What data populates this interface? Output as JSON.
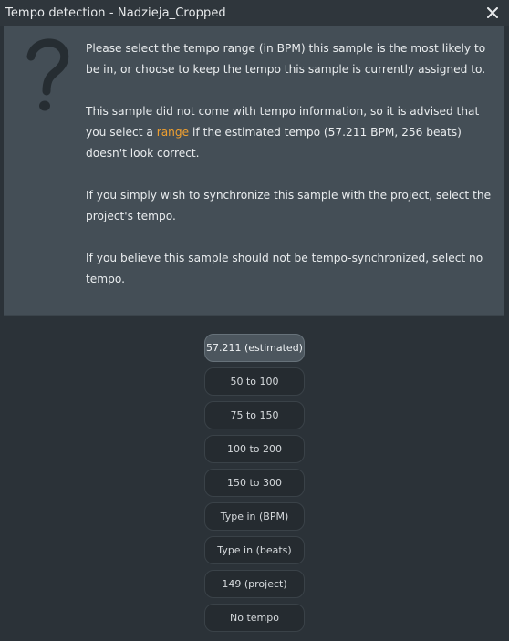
{
  "window": {
    "title": "Tempo detection - Nadzieja_Cropped",
    "close_icon": "close-x-icon"
  },
  "message": {
    "icon": "question-mark-icon",
    "paragraphs": {
      "p1": "Please select the tempo range (in BPM) this sample is the most likely to be in, or choose to keep the tempo this sample is currently assigned to.",
      "p2_before": "This sample did not come with tempo information, so it is advised that you select a ",
      "p2_link": "range",
      "p2_after": " if the estimated tempo (57.211 BPM, 256 beats) doesn't look correct.",
      "p3": "If you simply wish to synchronize this sample with the project, select the project's tempo.",
      "p4": "If you believe this sample should not be tempo-synchronized, select no tempo."
    }
  },
  "options": {
    "estimated": "57.211 (estimated)",
    "range_50_100": "50 to 100",
    "range_75_150": "75 to 150",
    "range_100_200": "100 to 200",
    "range_150_300": "150 to 300",
    "type_bpm": "Type in (BPM)",
    "type_beats": "Type in (beats)",
    "project": "149 (project)",
    "no_tempo": "No tempo"
  },
  "colors": {
    "background": "#2b3238",
    "panel": "#444e56",
    "link_accent": "#f0a030",
    "button": "#252b30",
    "button_selected": "#4c565e"
  }
}
